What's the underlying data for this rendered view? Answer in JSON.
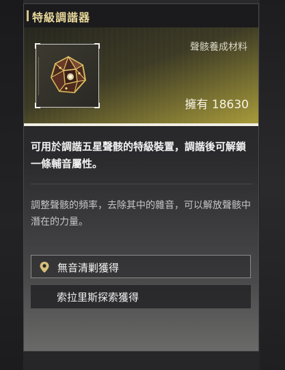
{
  "panel": {
    "title": "特級調諧器",
    "category": "聲骸養成材料",
    "owned_label": "擁有",
    "owned_count": "18630",
    "owned_text": "擁有 18630",
    "description": "可用於調諧五星聲骸的特級裝置，調諧後可解鎖一條輔音屬性。",
    "flavor": "調整聲骸的頻率，去除其中的雜音，可以解放聲骸中潛在的力量。",
    "sources": [
      {
        "label": "無音清剿獲得",
        "icon": "location-pin-icon"
      },
      {
        "label": "索拉里斯探索獲得",
        "icon": ""
      }
    ]
  },
  "colors": {
    "title": "#e8d89a",
    "header_glow": "#a79a3a",
    "pin": "#d6c07a"
  }
}
